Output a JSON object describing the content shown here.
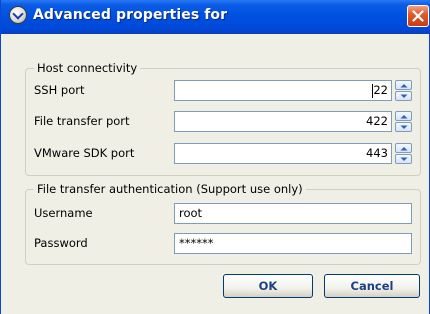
{
  "window": {
    "title": "Advanced properties for"
  },
  "host_connectivity": {
    "legend": "Host connectivity",
    "ssh_port": {
      "label": "SSH port",
      "value": "22"
    },
    "file_transfer_port": {
      "label": "File transfer port",
      "value": "422"
    },
    "vmware_sdk_port": {
      "label": "VMware SDK port",
      "value": "443"
    }
  },
  "file_transfer_auth": {
    "legend": "File transfer authentication (Support use only)",
    "username": {
      "label": "Username",
      "value": "root"
    },
    "password": {
      "label": "Password",
      "value": "******"
    }
  },
  "buttons": {
    "ok": "OK",
    "cancel": "Cancel"
  },
  "icons": {
    "title": "app-icon",
    "close": "close-icon",
    "spin_up": "chevron-up-icon",
    "spin_down": "chevron-down-icon"
  },
  "colors": {
    "titlebar": "#0050e0",
    "close_button": "#e25a2d",
    "button_text": "#1f3f82",
    "input_border": "#7f9db9"
  }
}
